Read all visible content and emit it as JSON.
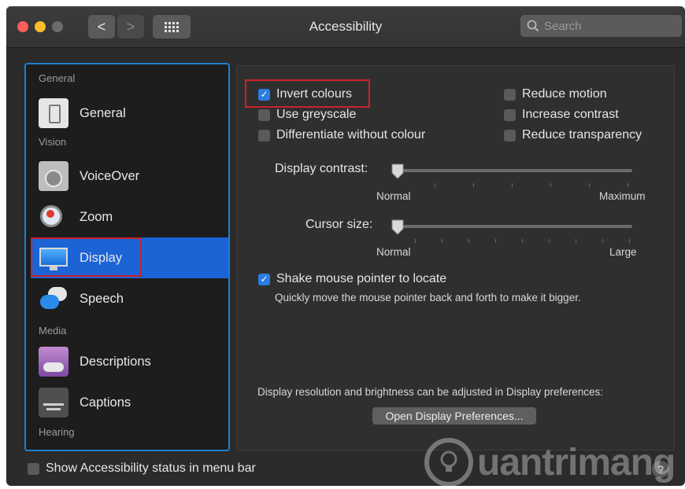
{
  "window": {
    "title": "Accessibility"
  },
  "toolbar": {
    "back": "<",
    "forward": ">",
    "grid": "⠿",
    "search_placeholder": "Search"
  },
  "sidebar": {
    "sections": {
      "general": "General",
      "vision": "Vision",
      "media": "Media",
      "hearing": "Hearing"
    },
    "items": [
      {
        "label": "General"
      },
      {
        "label": "VoiceOver"
      },
      {
        "label": "Zoom"
      },
      {
        "label": "Display"
      },
      {
        "label": "Speech"
      },
      {
        "label": "Descriptions"
      },
      {
        "label": "Captions"
      }
    ],
    "selected": "Display"
  },
  "display": {
    "checkboxes": {
      "invert_colours": {
        "label": "Invert colours",
        "checked": true
      },
      "use_greyscale": {
        "label": "Use greyscale",
        "checked": false
      },
      "differentiate": {
        "label": "Differentiate without colour",
        "checked": false
      },
      "reduce_motion": {
        "label": "Reduce motion",
        "checked": false
      },
      "increase_contrast": {
        "label": "Increase contrast",
        "checked": false
      },
      "reduce_transparency": {
        "label": "Reduce transparency",
        "checked": false
      }
    },
    "contrast": {
      "label": "Display contrast:",
      "min": "Normal",
      "max": "Maximum",
      "value": 0
    },
    "cursor": {
      "label": "Cursor size:",
      "min": "Normal",
      "max": "Large",
      "value": 0
    },
    "shake": {
      "label": "Shake mouse pointer to locate",
      "checked": true,
      "description": "Quickly move the mouse pointer back and forth to make it bigger."
    },
    "resolution_note": "Display resolution and brightness can be adjusted in Display preferences:",
    "open_button": "Open Display Preferences..."
  },
  "footer": {
    "status_label": "Show Accessibility status in menu bar",
    "help": "?"
  },
  "watermark": {
    "text": "uantrimang"
  },
  "colors": {
    "accent": "#2a7de1",
    "selected": "#1c64d6",
    "highlight": "#d0202a"
  }
}
